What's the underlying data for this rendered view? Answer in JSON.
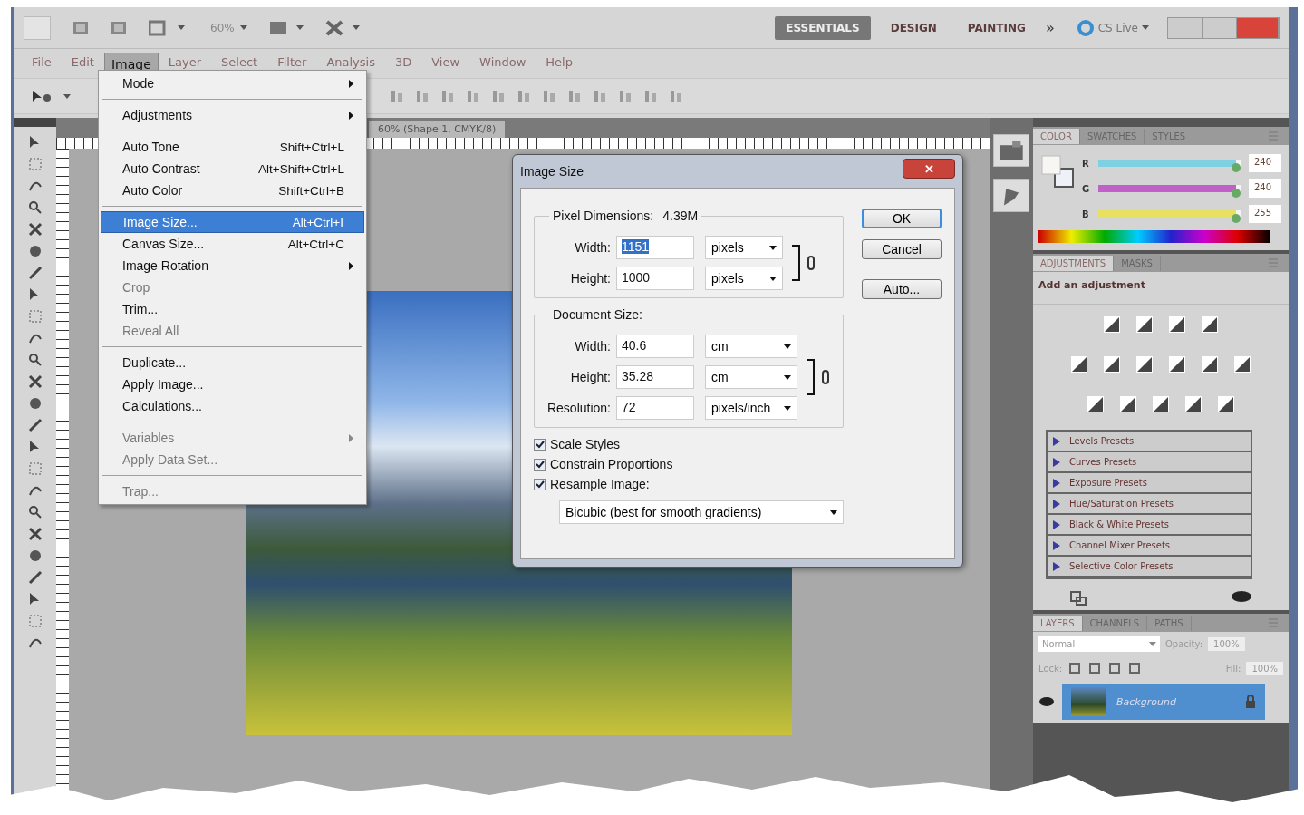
{
  "app_bar": {
    "zoom": "60%",
    "workspaces": [
      {
        "label": "ESSENTIALS",
        "selected": true
      },
      {
        "label": "DESIGN",
        "selected": false
      },
      {
        "label": "PAINTING",
        "selected": false
      }
    ],
    "more": "»",
    "cs_live": "CS Live"
  },
  "menu_bar": [
    {
      "label": "File",
      "selected": false
    },
    {
      "label": "Edit",
      "selected": false
    },
    {
      "label": "Image",
      "selected": true
    },
    {
      "label": "Layer",
      "selected": false
    },
    {
      "label": "Select",
      "selected": false
    },
    {
      "label": "Filter",
      "selected": false
    },
    {
      "label": "Analysis",
      "selected": false
    },
    {
      "label": "3D",
      "selected": false
    },
    {
      "label": "View",
      "selected": false
    },
    {
      "label": "Window",
      "selected": false
    },
    {
      "label": "Help",
      "selected": false
    }
  ],
  "document_tab": {
    "title": "60% (Shape 1, CMYK/8)"
  },
  "image_menu": [
    {
      "kind": "item",
      "label": "Mode",
      "submenu": true,
      "disabled": false,
      "selected": false
    },
    {
      "kind": "separator"
    },
    {
      "kind": "item",
      "label": "Adjustments",
      "submenu": true,
      "disabled": false,
      "selected": false
    },
    {
      "kind": "separator"
    },
    {
      "kind": "item",
      "label": "Auto Tone",
      "shortcut": "Shift+Ctrl+L",
      "submenu": false,
      "disabled": false,
      "selected": false
    },
    {
      "kind": "item",
      "label": "Auto Contrast",
      "shortcut": "Alt+Shift+Ctrl+L",
      "submenu": false,
      "disabled": false,
      "selected": false
    },
    {
      "kind": "item",
      "label": "Auto Color",
      "shortcut": "Shift+Ctrl+B",
      "submenu": false,
      "disabled": false,
      "selected": false
    },
    {
      "kind": "separator"
    },
    {
      "kind": "item",
      "label": "Image Size...",
      "shortcut": "Alt+Ctrl+I",
      "submenu": false,
      "disabled": false,
      "selected": true
    },
    {
      "kind": "item",
      "label": "Canvas Size...",
      "shortcut": "Alt+Ctrl+C",
      "submenu": false,
      "disabled": false,
      "selected": false
    },
    {
      "kind": "item",
      "label": "Image Rotation",
      "submenu": true,
      "disabled": false,
      "selected": false
    },
    {
      "kind": "item",
      "label": "Crop",
      "submenu": false,
      "disabled": true,
      "selected": false
    },
    {
      "kind": "item",
      "label": "Trim...",
      "submenu": false,
      "disabled": false,
      "selected": false
    },
    {
      "kind": "item",
      "label": "Reveal All",
      "submenu": false,
      "disabled": true,
      "selected": false
    },
    {
      "kind": "separator"
    },
    {
      "kind": "item",
      "label": "Duplicate...",
      "submenu": false,
      "disabled": false,
      "selected": false
    },
    {
      "kind": "item",
      "label": "Apply Image...",
      "submenu": false,
      "disabled": false,
      "selected": false
    },
    {
      "kind": "item",
      "label": "Calculations...",
      "submenu": false,
      "disabled": false,
      "selected": false
    },
    {
      "kind": "separator"
    },
    {
      "kind": "item",
      "label": "Variables",
      "submenu": true,
      "disabled": true,
      "selected": false
    },
    {
      "kind": "item",
      "label": "Apply Data Set...",
      "submenu": false,
      "disabled": true,
      "selected": false
    },
    {
      "kind": "separator"
    },
    {
      "kind": "item",
      "label": "Trap...",
      "submenu": false,
      "disabled": true,
      "selected": false
    }
  ],
  "dialog": {
    "title": "Image Size",
    "close": "✕",
    "pixel_dimensions": {
      "label": "Pixel Dimensions:",
      "value": "4.39M",
      "rows": [
        {
          "label": "Width:",
          "value": "1151",
          "selected": true,
          "unit": "pixels"
        },
        {
          "label": "Height:",
          "value": "1000",
          "selected": false,
          "unit": "pixels"
        }
      ]
    },
    "document_size": {
      "label": "Document Size:",
      "rows": [
        {
          "label": "Width:",
          "value": "40.6",
          "selected": false,
          "unit": "cm"
        },
        {
          "label": "Height:",
          "value": "35.28",
          "selected": false,
          "unit": "cm"
        },
        {
          "label": "Resolution:",
          "value": "72",
          "selected": false,
          "unit": "pixels/inch"
        }
      ]
    },
    "checkboxes": [
      {
        "label": "Scale Styles",
        "checked": true
      },
      {
        "label": "Constrain Proportions",
        "checked": true
      },
      {
        "label": "Resample Image:",
        "checked": true
      }
    ],
    "method": "Bicubic (best for smooth gradients)",
    "buttons": [
      {
        "label": "OK",
        "default": true
      },
      {
        "label": "Cancel",
        "default": false
      },
      {
        "label": "Auto...",
        "default": false
      }
    ]
  },
  "color_panel": {
    "tabs": [
      {
        "label": "COLOR",
        "selected": true
      },
      {
        "label": "SWATCHES",
        "selected": false
      },
      {
        "label": "STYLES",
        "selected": false
      }
    ],
    "channels": [
      {
        "name": "R",
        "level": 0.96,
        "reading": "240",
        "color": "#7fd0e0"
      },
      {
        "name": "G",
        "level": 0.96,
        "reading": "240",
        "color": "#c060c8"
      },
      {
        "name": "B",
        "level": 0.96,
        "reading": "255",
        "color": "#e8e060"
      }
    ]
  },
  "adjustments_panel": {
    "tabs": [
      {
        "label": "ADJUSTMENTS",
        "selected": true
      },
      {
        "label": "MASKS",
        "selected": false
      }
    ],
    "heading": "Add an adjustment",
    "presets": [
      "Levels Presets",
      "Curves Presets",
      "Exposure Presets",
      "Hue/Saturation Presets",
      "Black & White Presets",
      "Channel Mixer Presets",
      "Selective Color Presets"
    ]
  },
  "layers_panel": {
    "tabs": [
      {
        "label": "LAYERS",
        "selected": true
      },
      {
        "label": "CHANNELS",
        "selected": false
      },
      {
        "label": "PATHS",
        "selected": false
      }
    ],
    "blend_mode": "Normal",
    "opacity_label": "Opacity:",
    "opacity": "100%",
    "lock_label": "Lock:",
    "fill_label": "Fill:",
    "fill": "100%",
    "layers": [
      {
        "name": "Background",
        "selected": true
      }
    ]
  }
}
